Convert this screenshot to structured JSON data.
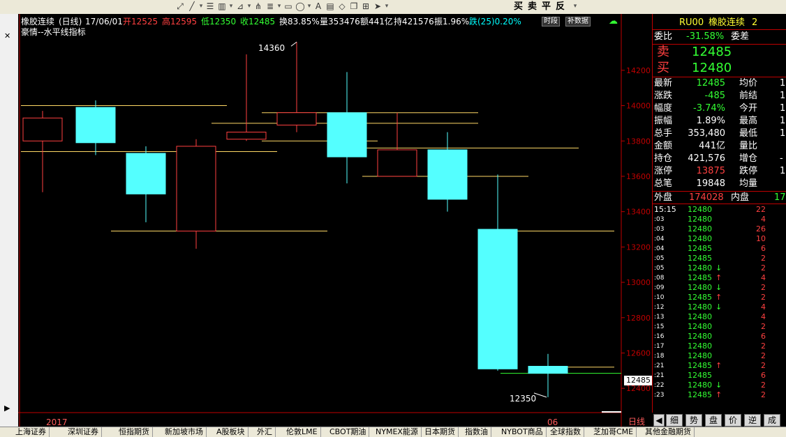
{
  "toolbar": {
    "icons": [
      "cursor-icon",
      "line-icon",
      "text-icon",
      "column-icon",
      "level-icon",
      "fork-icon",
      "fib-icon",
      "rect-icon",
      "circle-icon",
      "text-a-icon",
      "doc-icon",
      "eraser-icon",
      "copy-icon",
      "grid-icon",
      "arrow-icon"
    ],
    "trade_buttons": [
      "买",
      "卖",
      "平",
      "反"
    ]
  },
  "chart_header": {
    "name": "橡胶连续",
    "period": "(日线)",
    "date": "17/06/01",
    "open": "开12525",
    "high": "高12595",
    "low": "低12350",
    "close": "收12485",
    "turnover": "换83.85%",
    "volume": "量353476",
    "amount": "额441亿",
    "hold": "持421576",
    "amplitude": "振1.96%",
    "change": "跌(25)0.20%",
    "subtitle": "豪情--水平线指标",
    "btn_timeshare": "时段",
    "btn_supplement": "补数据"
  },
  "chart_labels": {
    "max_label": "14360",
    "min_label": "12350",
    "x_start": "2017",
    "x_end": "06",
    "period_label": "日线",
    "current_price_tag": "12485"
  },
  "colors": {
    "up": "#ff4040",
    "down_fill": "#54ffff",
    "hline": "#ffd966",
    "axis": "#c00000",
    "green_line": "#33ff33"
  },
  "chart_data": {
    "type": "candlestick",
    "y_ticks": [
      14200,
      14000,
      13800,
      13600,
      13400,
      13200,
      13000,
      12800,
      12600,
      12400
    ],
    "ylim": [
      12310,
      14440
    ],
    "candles": [
      {
        "open": 13800,
        "close": 13930,
        "high": 13970,
        "low": 13510
      },
      {
        "open": 13990,
        "close": 13790,
        "high": 14030,
        "low": 13720
      },
      {
        "open": 13730,
        "close": 13500,
        "high": 13770,
        "low": 13340
      },
      {
        "open": 13290,
        "close": 13770,
        "high": 13810,
        "low": 13190
      },
      {
        "open": 13810,
        "close": 13850,
        "high": 14290,
        "low": 13800
      },
      {
        "open": 13890,
        "close": 13960,
        "high": 14360,
        "low": 13850
      },
      {
        "open": 13960,
        "close": 13710,
        "high": 14190,
        "low": 13560
      },
      {
        "open": 13600,
        "close": 13750,
        "high": 13960,
        "low": 13600
      },
      {
        "open": 13750,
        "close": 13470,
        "high": 13850,
        "low": 13400
      },
      {
        "open": 13300,
        "close": 12510,
        "high": 13610,
        "low": 12500
      },
      {
        "open": 12525,
        "close": 12485,
        "high": 12595,
        "low": 12350
      }
    ],
    "hlines": [
      {
        "y": 14000,
        "from": 0,
        "to": 4
      },
      {
        "y": 13740,
        "from": 0,
        "to": 5
      },
      {
        "y": 13290,
        "from": 2,
        "to": 6
      },
      {
        "y": 13900,
        "from": 4,
        "to": 9
      },
      {
        "y": 13800,
        "from": 5,
        "to": 7
      },
      {
        "y": 13600,
        "from": 7,
        "to": 10
      },
      {
        "y": 13960,
        "from": 5,
        "to": 9
      },
      {
        "y": 13760,
        "from": 7,
        "to": 11
      },
      {
        "y": 13290,
        "from": 10,
        "to": 12
      },
      {
        "y": 12520,
        "from": 11,
        "to": 13
      }
    ],
    "green_hline": 12485
  },
  "quote": {
    "code": "RU00",
    "name": "橡胶连续",
    "extra": "2",
    "weibi_label": "委比",
    "weibi_value": "-31.58%",
    "weicha_label": "委差",
    "sell_label": "卖",
    "sell_price": "12485",
    "buy_label": "买",
    "buy_price": "12480",
    "rows": [
      {
        "l1": "最新",
        "v1": "12485",
        "v1c": "g",
        "l2": "均价",
        "v2": "1"
      },
      {
        "l1": "涨跌",
        "v1": "-485",
        "v1c": "g",
        "l2": "前结",
        "v2": "1"
      },
      {
        "l1": "幅度",
        "v1": "-3.74%",
        "v1c": "g",
        "l2": "今开",
        "v2": "1"
      },
      {
        "l1": "振幅",
        "v1": "1.89%",
        "v1c": "w",
        "l2": "最高",
        "v2": "1"
      },
      {
        "l1": "总手",
        "v1": "353,480",
        "v1c": "w",
        "l2": "最低",
        "v2": "1"
      },
      {
        "l1": "金额",
        "v1": "441亿",
        "v1c": "w",
        "l2": "量比",
        "v2": ""
      },
      {
        "l1": "持仓",
        "v1": "421,576",
        "v1c": "w",
        "l2": "增仓",
        "v2": "-"
      },
      {
        "l1": "涨停",
        "v1": "13875",
        "v1c": "r",
        "l2": "跌停",
        "v2": "1"
      },
      {
        "l1": "总笔",
        "v1": "19848",
        "v1c": "w",
        "l2": "均量",
        "v2": ""
      }
    ],
    "outer_label": "外盘",
    "outer_value": "174028",
    "inner_label": "内盘",
    "inner_value": "17"
  },
  "ticks": [
    {
      "t": "15:15",
      "p": "12480",
      "a": "",
      "v": "22"
    },
    {
      "t": ":03",
      "p": "12480",
      "a": "",
      "v": "4"
    },
    {
      "t": ":03",
      "p": "12480",
      "a": "",
      "v": "26"
    },
    {
      "t": ":04",
      "p": "12480",
      "a": "",
      "v": "10"
    },
    {
      "t": ":04",
      "p": "12485",
      "a": "",
      "v": "6"
    },
    {
      "t": ":05",
      "p": "12485",
      "a": "",
      "v": "2"
    },
    {
      "t": ":05",
      "p": "12480",
      "a": "↓",
      "v": "2"
    },
    {
      "t": ":08",
      "p": "12485",
      "a": "↑",
      "v": "4"
    },
    {
      "t": ":09",
      "p": "12480",
      "a": "↓",
      "v": "2"
    },
    {
      "t": ":10",
      "p": "12485",
      "a": "↑",
      "v": "2"
    },
    {
      "t": ":12",
      "p": "12480",
      "a": "↓",
      "v": "4"
    },
    {
      "t": ":13",
      "p": "12480",
      "a": "",
      "v": "4"
    },
    {
      "t": ":15",
      "p": "12480",
      "a": "",
      "v": "2"
    },
    {
      "t": ":16",
      "p": "12480",
      "a": "",
      "v": "6"
    },
    {
      "t": ":17",
      "p": "12480",
      "a": "",
      "v": "2"
    },
    {
      "t": ":18",
      "p": "12480",
      "a": "",
      "v": "2"
    },
    {
      "t": ":21",
      "p": "12485",
      "a": "↑",
      "v": "2"
    },
    {
      "t": ":21",
      "p": "12485",
      "a": "",
      "v": "6"
    },
    {
      "t": ":22",
      "p": "12480",
      "a": "↓",
      "v": "2"
    },
    {
      "t": ":23",
      "p": "12485",
      "a": "↑",
      "v": "2"
    }
  ],
  "right_tabs": [
    "细",
    "势",
    "盘",
    "价",
    "逆",
    "成"
  ],
  "bottom_tabs": [
    "上海证券",
    "深圳证券",
    "恒指期货",
    "新加坡市场",
    "A股板块",
    "外汇",
    "伦敦LME",
    "CBOT期油",
    "NYMEX能源",
    "日本期货",
    "指数油",
    "NYBOT商品",
    "全球指数",
    "芝加哥CME",
    "其他金融期货"
  ]
}
